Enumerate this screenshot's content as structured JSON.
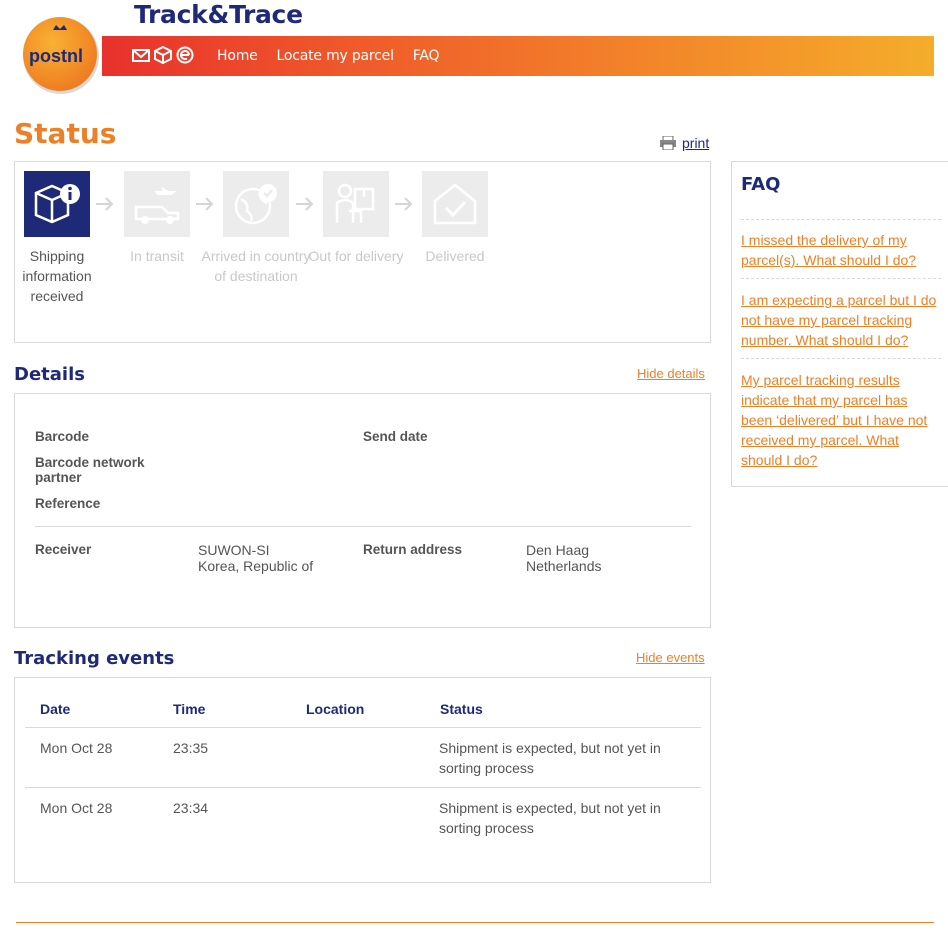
{
  "header": {
    "logo_text": "postnl",
    "app_title": "Track&Trace",
    "nav": [
      {
        "label": "Home"
      },
      {
        "label": "Locate my parcel"
      },
      {
        "label": "FAQ"
      }
    ],
    "nav_icons": [
      "mail-icon",
      "parcel-icon",
      "e-commerce-icon"
    ]
  },
  "status": {
    "title": "Status",
    "print_label": "print",
    "steps": [
      {
        "label": "Shipping information received",
        "icon": "box-info-icon",
        "active": true
      },
      {
        "label": "In transit",
        "icon": "van-plane-icon",
        "active": false
      },
      {
        "label": "Arrived in country of destination",
        "icon": "globe-check-icon",
        "active": false
      },
      {
        "label": "Out for delivery",
        "icon": "courier-icon",
        "active": false
      },
      {
        "label": "Delivered",
        "icon": "house-check-icon",
        "active": false
      }
    ]
  },
  "details": {
    "title": "Details",
    "toggle": "Hide details",
    "barcode_label": "Barcode",
    "send_date_label": "Send date",
    "network_partner_label": "Barcode network partner",
    "reference_label": "Reference",
    "receiver_label": "Receiver",
    "receiver_line1": "SUWON-SI",
    "receiver_line2": "Korea, Republic of",
    "return_label": "Return address",
    "return_line1": "Den Haag",
    "return_line2": "Netherlands"
  },
  "tracking": {
    "title": "Tracking events",
    "toggle": "Hide events",
    "columns": [
      "Date",
      "Time",
      "Location",
      "Status"
    ],
    "rows": [
      {
        "date": "Mon Oct 28",
        "time": "23:35",
        "location": "",
        "status": "Shipment is expected, but not yet in sorting process"
      },
      {
        "date": "Mon Oct 28",
        "time": "23:34",
        "location": "",
        "status": "Shipment is expected, but not yet in sorting process"
      }
    ]
  },
  "faq": {
    "title": "FAQ",
    "items": [
      "I missed the delivery of my parcel(s). What should I do?",
      "I am expecting a parcel but I do not have my parcel tracking number. What should I do?",
      "My parcel tracking results indicate that my parcel has been ‘delivered’ but I have not received my parcel. What should I do?"
    ]
  },
  "colors": {
    "brand_orange": "#ed8026",
    "brand_navy": "#1e2a78",
    "nav_gradient_start": "#e8312c",
    "nav_gradient_end": "#f4ad2b"
  }
}
